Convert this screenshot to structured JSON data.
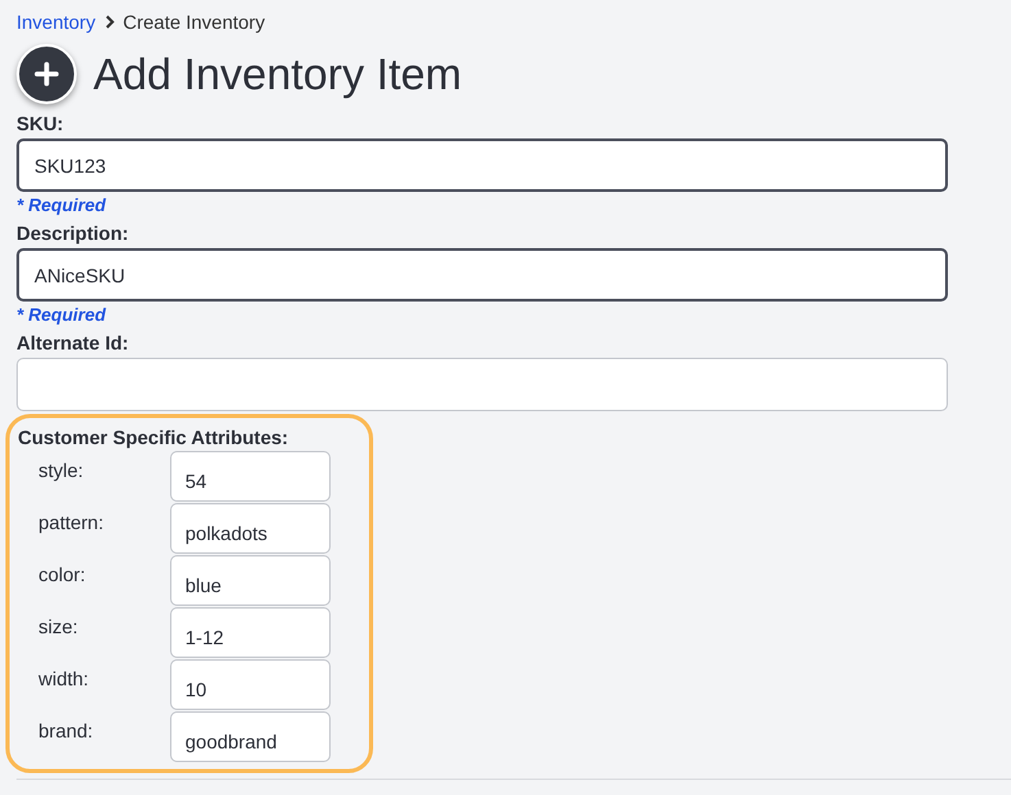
{
  "breadcrumb": [
    {
      "label": "Inventory",
      "kind": "link"
    },
    {
      "label": "Create Inventory",
      "kind": "current"
    }
  ],
  "title": "Add Inventory Item",
  "fields": [
    {
      "label": "SKU:",
      "value": "SKU123",
      "required": true,
      "note": "* Required"
    },
    {
      "label": "Description:",
      "value": "ANiceSKU",
      "required": true,
      "note": "* Required"
    },
    {
      "label": "Alternate Id:",
      "required": false
    }
  ],
  "attributes": {
    "title": "Customer Specific Attributes:",
    "highlighted": true,
    "items": [
      {
        "label": "style:",
        "value": "54"
      },
      {
        "label": "pattern:",
        "value": "polkadots"
      },
      {
        "label": "color:",
        "value": "blue"
      },
      {
        "label": "size:",
        "value": "1-12"
      },
      {
        "label": "width:",
        "value": "10"
      },
      {
        "label": "brand:",
        "value": "goodbrand"
      }
    ]
  }
}
